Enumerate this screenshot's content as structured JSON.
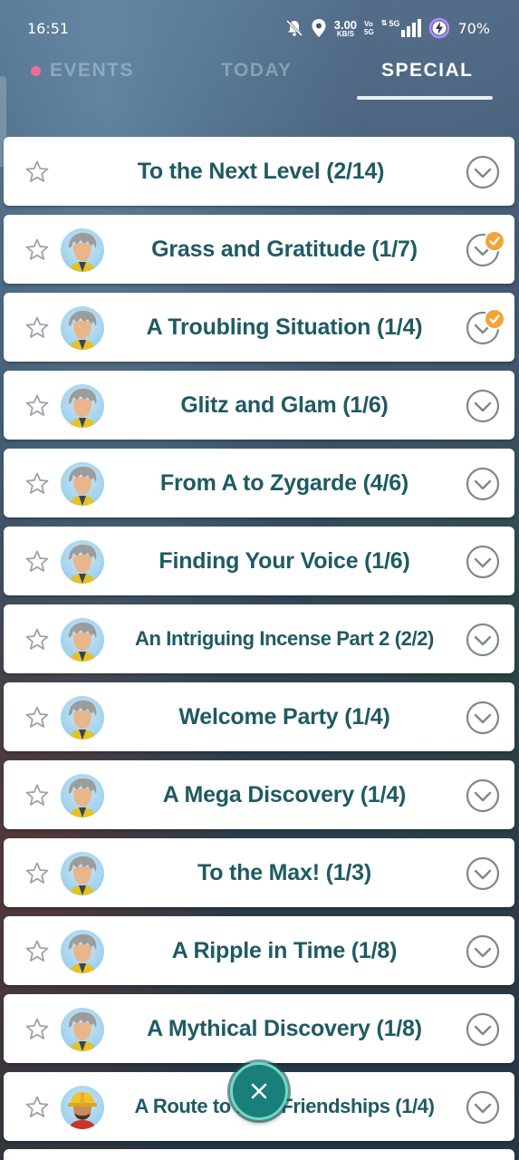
{
  "status_bar": {
    "time": "16:51",
    "net_speed_value": "3.00",
    "net_speed_unit": "KB/S",
    "volte_top": "Vo",
    "volte_bottom": "5G",
    "network": "5G",
    "battery": "70%",
    "icons": [
      "mute-icon",
      "location-icon",
      "signal-icon",
      "battery-saver-icon"
    ]
  },
  "tabs": [
    {
      "label": "EVENTS",
      "active": false,
      "has_dot": true,
      "dot_color": "#f06a9a"
    },
    {
      "label": "TODAY",
      "active": false
    },
    {
      "label": "SPECIAL",
      "active": true
    }
  ],
  "research": [
    {
      "title": "To the Next Level (2/14)",
      "avatar": "none",
      "completed_badge": false
    },
    {
      "title": "Grass and Gratitude (1/7)",
      "avatar": "professor-willow",
      "completed_badge": true
    },
    {
      "title": "A Troubling Situation (1/4)",
      "avatar": "professor-willow",
      "completed_badge": true
    },
    {
      "title": "Glitz and Glam (1/6)",
      "avatar": "professor-willow",
      "completed_badge": false
    },
    {
      "title": "From A to Zygarde (4/6)",
      "avatar": "professor-willow",
      "completed_badge": false
    },
    {
      "title": "Finding Your Voice (1/6)",
      "avatar": "professor-willow",
      "completed_badge": false
    },
    {
      "title": "An Intriguing Incense Part 2 (2/2)",
      "avatar": "professor-willow",
      "completed_badge": false
    },
    {
      "title": "Welcome Party (1/4)",
      "avatar": "professor-willow",
      "completed_badge": false
    },
    {
      "title": "A Mega Discovery (1/4)",
      "avatar": "professor-willow",
      "completed_badge": false
    },
    {
      "title": "To the Max! (1/3)",
      "avatar": "professor-willow",
      "completed_badge": false
    },
    {
      "title": "A Ripple in Time (1/8)",
      "avatar": "professor-willow",
      "completed_badge": false
    },
    {
      "title": "A Mythical Discovery (1/8)",
      "avatar": "professor-willow",
      "completed_badge": false
    },
    {
      "title": "A Route to New Friendships (1/4)",
      "avatar": "hardhat-character",
      "completed_badge": false
    }
  ],
  "colors": {
    "title_text": "#1f5a63",
    "accent_teal": "#1a7f7a",
    "badge_orange": "#f2a43a",
    "tab_active": "#ffffff"
  }
}
